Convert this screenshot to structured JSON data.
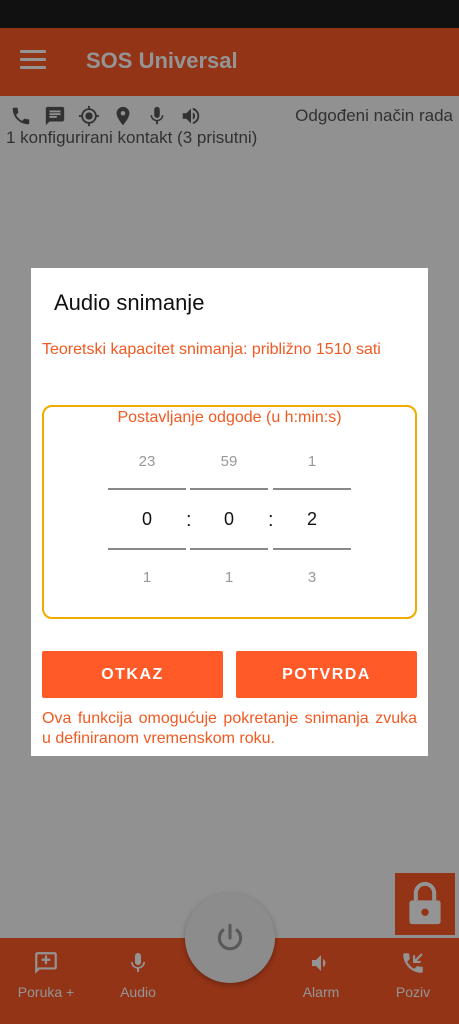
{
  "app": {
    "title": "SOS Universal"
  },
  "status": {
    "mode_label": "Odgođeni način rada",
    "contacts_label": "1 konfigurirani kontakt (3 prisutni)"
  },
  "status_icons": [
    "phone-icon",
    "message-icon",
    "gps-target-icon",
    "location-pin-icon",
    "microphone-icon",
    "speaker-icon"
  ],
  "bottom_nav": {
    "items": [
      {
        "label": "Poruka +",
        "icon": "add-message-icon"
      },
      {
        "label": "Audio",
        "icon": "microphone-icon"
      },
      {
        "label": "Alarm",
        "icon": "speaker-icon"
      },
      {
        "label": "Poziv",
        "icon": "incoming-call-icon"
      }
    ]
  },
  "dialog": {
    "title": "Audio snimanje",
    "capacity_text": "Teoretski kapacitet snimanja: približno 1510 sati",
    "picker_label": "Postavljanje odgode (u h:min:s)",
    "hours": {
      "prev": "23",
      "value": "0",
      "next": "1"
    },
    "minutes": {
      "prev": "59",
      "value": "0",
      "next": "1"
    },
    "seconds": {
      "prev": "1",
      "value": "2",
      "next": "3"
    },
    "separator": ":",
    "cancel_label": "OTKAZ",
    "confirm_label": "POTVRDA",
    "info_text": "Ova funkcija omogućuje pokretanje snimanja zvuka u definiranom vremenskom roku."
  },
  "colors": {
    "accent": "#ff5a27",
    "accent_text": "#f05a22",
    "picker_border": "#f2a900",
    "scrim": "rgba(0,0,0,0.42)"
  }
}
